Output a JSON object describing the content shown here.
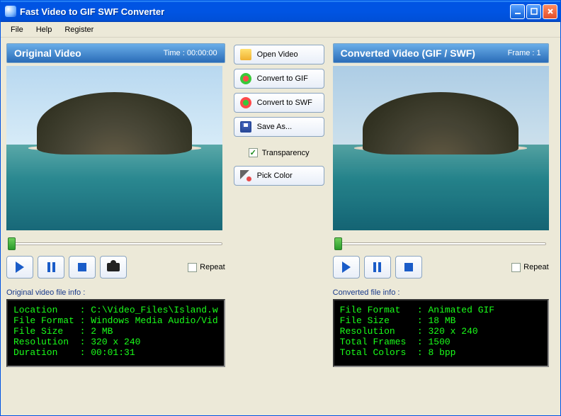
{
  "window": {
    "title": "Fast Video to GIF SWF Converter"
  },
  "menu": {
    "file": "File",
    "help": "Help",
    "register": "Register"
  },
  "left": {
    "header": "Original Video",
    "meta": "Time : 00:00:00",
    "repeat": "Repeat",
    "info_label": "Original video file info :",
    "info_text": "Location    : C:\\Video_Files\\Island.w\nFile Format : Windows Media Audio/Vid\nFile Size   : 2 MB\nResolution  : 320 x 240\nDuration    : 00:01:31"
  },
  "right": {
    "header": "Converted Video (GIF / SWF)",
    "meta": "Frame : 1",
    "repeat": "Repeat",
    "info_label": "Converted file info :",
    "info_text": "File Format   : Animated GIF\nFile Size     : 18 MB\nResolution    : 320 x 240\nTotal Frames  : 1500\nTotal Colors  : 8 bpp"
  },
  "actions": {
    "open": "Open Video",
    "to_gif": "Convert to GIF",
    "to_swf": "Convert to SWF",
    "save_as": "Save As...",
    "transparency": "Transparency",
    "pick_color": "Pick Color"
  }
}
